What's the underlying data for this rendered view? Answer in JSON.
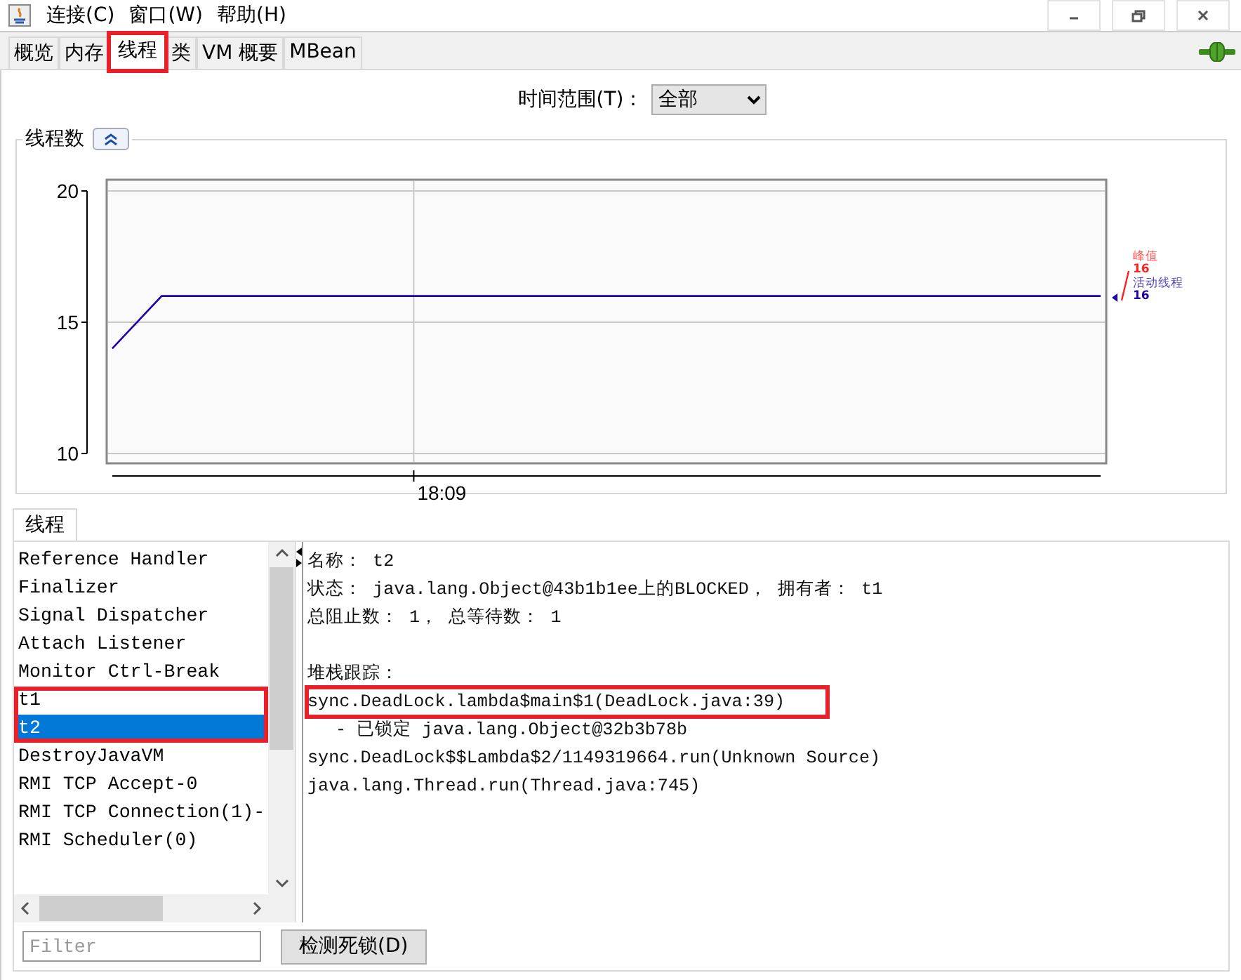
{
  "window": {
    "menus": [
      "连接(C)",
      "窗口(W)",
      "帮助(H)"
    ]
  },
  "tabs": [
    {
      "label": "概览",
      "selected": false,
      "highlighted": false
    },
    {
      "label": "内存",
      "selected": false,
      "highlighted": false
    },
    {
      "label": "线程",
      "selected": true,
      "highlighted": true
    },
    {
      "label": "类",
      "selected": false,
      "highlighted": false
    },
    {
      "label": "VM 概要",
      "selected": false,
      "highlighted": false
    },
    {
      "label": "MBean",
      "selected": false,
      "highlighted": false
    }
  ],
  "time_range": {
    "label": "时间范围(T)：",
    "value": "全部"
  },
  "thread_chart": {
    "title": "线程数",
    "chart_data": {
      "type": "line",
      "ylim": [
        10,
        20
      ],
      "yticks": [
        {
          "value": 10,
          "label": "10"
        },
        {
          "value": 15,
          "label": "15"
        },
        {
          "value": 20,
          "label": "20"
        }
      ],
      "annotations": [
        "18:09"
      ],
      "series": [
        {
          "name": "活动线程",
          "color": "#2200aa",
          "values": [
            14,
            16,
            16,
            16,
            16,
            16,
            16,
            16,
            16,
            16,
            16,
            16,
            16,
            16,
            16,
            16,
            16,
            16,
            16,
            16,
            16
          ]
        }
      ]
    },
    "peak": {
      "label": "峰值",
      "value": "16",
      "color": "#ff2020"
    },
    "current_value": "16"
  },
  "lower_tabs": [
    {
      "label": "线程",
      "selected": true
    }
  ],
  "threads": [
    {
      "name": "Reference Handler",
      "selected": false,
      "highlighted": false
    },
    {
      "name": "Finalizer",
      "selected": false,
      "highlighted": false
    },
    {
      "name": "Signal Dispatcher",
      "selected": false,
      "highlighted": false
    },
    {
      "name": "Attach Listener",
      "selected": false,
      "highlighted": false
    },
    {
      "name": "Monitor Ctrl-Break",
      "selected": false,
      "highlighted": false
    },
    {
      "name": "t1",
      "selected": false,
      "highlighted": true
    },
    {
      "name": "t2",
      "selected": true,
      "highlighted": true
    },
    {
      "name": "DestroyJavaVM",
      "selected": false,
      "highlighted": false
    },
    {
      "name": "RMI TCP Accept-0",
      "selected": false,
      "highlighted": false
    },
    {
      "name": "RMI TCP Connection(1)-",
      "selected": false,
      "highlighted": false
    },
    {
      "name": "RMI Scheduler(0)",
      "selected": false,
      "highlighted": false
    }
  ],
  "details": {
    "info": [
      "名称： t2",
      "状态： java.lang.Object@43b1b1ee上的BLOCKED， 拥有者： t1",
      "总阻止数： 1， 总等待数： 1"
    ],
    "stack_label": "堆栈跟踪：",
    "stack": [
      {
        "kind": "frame",
        "text": "sync.DeadLock.lambda$main$1(DeadLock.java:39)",
        "highlighted": true
      },
      {
        "kind": "lock",
        "text": "- 已锁定 java.lang.Object@32b3b78b",
        "highlighted": false
      },
      {
        "kind": "frame",
        "text": "sync.DeadLock$$Lambda$2/1149319664.run(Unknown Source)",
        "highlighted": false
      },
      {
        "kind": "frame",
        "text": "java.lang.Thread.run(Thread.java:745)",
        "highlighted": false
      }
    ]
  },
  "filter": {
    "placeholder": "Filter"
  },
  "detect_button": "检测死锁(D)"
}
